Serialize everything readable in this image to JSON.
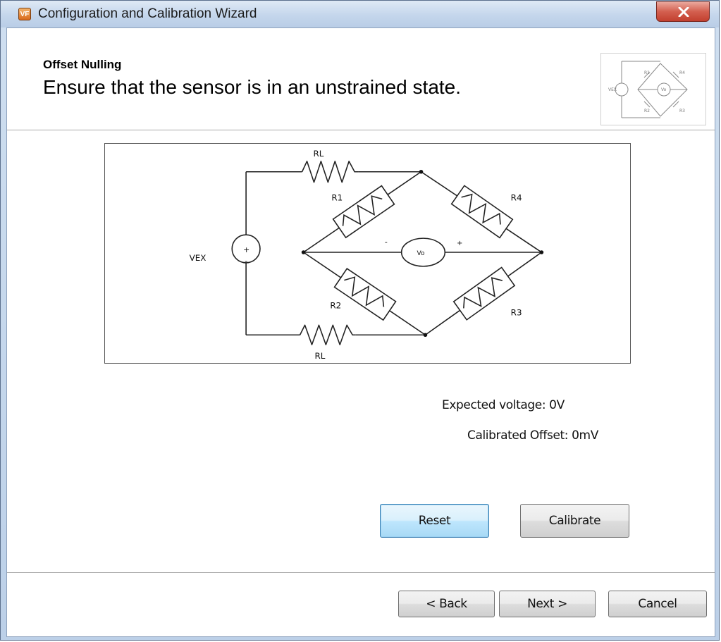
{
  "window": {
    "title": "Configuration and Calibration Wizard",
    "app_icon": "VF",
    "close_icon": "close-icon"
  },
  "header": {
    "step_title": "Offset Nulling",
    "step_description": "Ensure that the sensor is in an unstrained state."
  },
  "diagram": {
    "labels": {
      "rl_top": "RL",
      "rl_bottom": "RL",
      "r1": "R1",
      "r2": "R2",
      "r3": "R3",
      "r4": "R4",
      "vex": "VEX",
      "vo": "Vo",
      "plus_source": "+",
      "minus_source": "-",
      "minus_meter": "-",
      "plus_meter": "+"
    }
  },
  "info": {
    "expected_voltage": "Expected voltage: 0V",
    "calibrated_offset": "Calibrated Offset: 0mV"
  },
  "actions": {
    "reset": "Reset",
    "calibrate": "Calibrate"
  },
  "navigation": {
    "back": "< Back",
    "next": "Next >",
    "cancel": "Cancel"
  },
  "colors": {
    "title_bar": "#c4d6ec",
    "close_button": "#c94a3a",
    "focused_button": "#bee6fd"
  }
}
